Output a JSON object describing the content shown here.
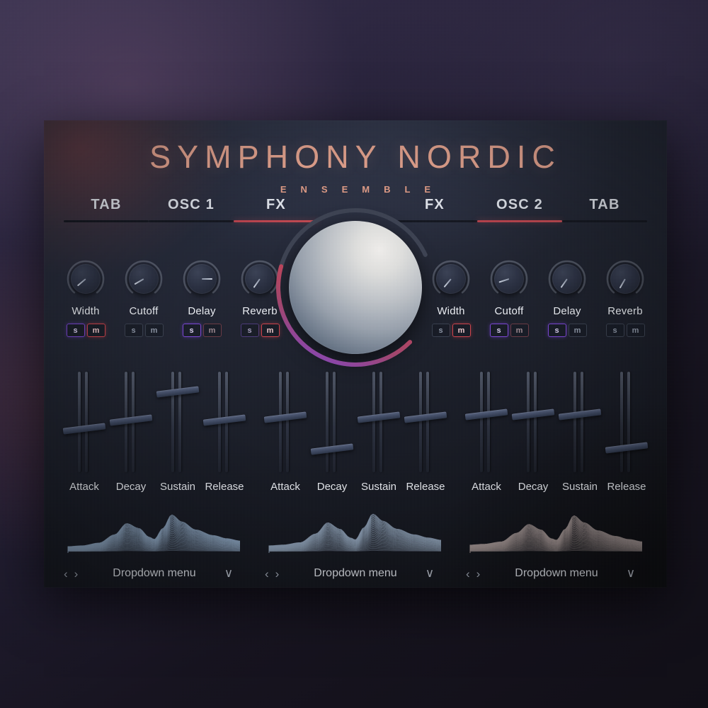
{
  "app": {
    "title": "SYMPHONY NORDIC",
    "subtitle": "ENSEMBLE",
    "accent_salmon": "#eca893",
    "accent_red": "#c24a52",
    "accent_purple": "#7b46d6",
    "panel_bg": "#242938"
  },
  "tabs": {
    "left": [
      {
        "label": "TAB",
        "active": false
      },
      {
        "label": "OSC 1",
        "active": false
      },
      {
        "label": "FX",
        "active": true
      }
    ],
    "right": [
      {
        "label": "FX",
        "active": false
      },
      {
        "label": "OSC 2",
        "active": true
      },
      {
        "label": "TAB",
        "active": false
      }
    ]
  },
  "knob_groups": [
    {
      "side": "left",
      "knobs": [
        {
          "label": "Width",
          "angle": -130,
          "arc": 0.18,
          "s_state": "on-purple",
          "m_state": "on-red"
        },
        {
          "label": "Cutoff",
          "angle": -120,
          "arc": 0.22,
          "s_state": "off",
          "m_state": "off"
        },
        {
          "label": "Delay",
          "angle": 90,
          "arc": 0.8,
          "s_state": "on-purple",
          "m_state": "dim-red"
        },
        {
          "label": "Reverb",
          "angle": -145,
          "arc": 0.1,
          "s_state": "dim-purple",
          "m_state": "on-red"
        }
      ]
    },
    {
      "side": "right",
      "knobs": [
        {
          "label": "Width",
          "angle": -140,
          "arc": 0.14,
          "s_state": "off",
          "m_state": "on-red"
        },
        {
          "label": "Cutoff",
          "angle": -108,
          "arc": 0.28,
          "s_state": "on-purple",
          "m_state": "dim-red"
        },
        {
          "label": "Delay",
          "angle": -145,
          "arc": 0.1,
          "s_state": "on-purple",
          "m_state": "off"
        },
        {
          "label": "Reverb",
          "angle": -150,
          "arc": 0.08,
          "s_state": "off",
          "m_state": "off"
        }
      ]
    }
  ],
  "sm_labels": {
    "solo": "s",
    "mute": "m"
  },
  "slider_groups": [
    {
      "name": "envelope-1",
      "sliders": [
        {
          "label": "Attack",
          "value": 44
        },
        {
          "label": "Decay",
          "value": 52
        },
        {
          "label": "Sustain",
          "value": 80
        },
        {
          "label": "Release",
          "value": 52
        }
      ]
    },
    {
      "name": "envelope-2",
      "sliders": [
        {
          "label": "Attack",
          "value": 55
        },
        {
          "label": "Decay",
          "value": 23
        },
        {
          "label": "Sustain",
          "value": 55
        },
        {
          "label": "Release",
          "value": 55
        }
      ]
    },
    {
      "name": "envelope-3",
      "sliders": [
        {
          "label": "Attack",
          "value": 58
        },
        {
          "label": "Decay",
          "value": 58
        },
        {
          "label": "Sustain",
          "value": 58
        },
        {
          "label": "Release",
          "value": 25
        }
      ]
    }
  ],
  "wave_panels": [
    {
      "name": "wave-1",
      "tint": "#8fa8c4",
      "dropdown": {
        "label": "Dropdown menu",
        "prev": "‹",
        "next": "›",
        "caret": "∨"
      }
    },
    {
      "name": "wave-2",
      "tint": "#93a6bd",
      "dropdown": {
        "label": "Dropdown menu",
        "prev": "‹",
        "next": "›",
        "caret": "∨"
      }
    },
    {
      "name": "wave-3",
      "tint": "#a89a98",
      "dropdown": {
        "label": "Dropdown menu",
        "prev": "‹",
        "next": "›",
        "caret": "∨"
      }
    }
  ],
  "center_knob": {
    "name": "master-sphere-knob",
    "arc_start_deg": 135,
    "arc_sweep_deg": 290,
    "value_fraction": 0.52,
    "arc_gradient_from": "#7b46d6",
    "arc_gradient_to": "#d2434a",
    "arc_track_color": "#3c4252"
  },
  "chart_data": {
    "type": "area",
    "title": "Ensemble spectrum ridgeline",
    "series": [
      {
        "name": "wave-1",
        "x": [
          0,
          0.08,
          0.18,
          0.27,
          0.34,
          0.41,
          0.47,
          0.5,
          0.55,
          0.6,
          0.66,
          0.74,
          0.84,
          0.92,
          1
        ],
        "values": [
          0.16,
          0.18,
          0.25,
          0.46,
          0.74,
          0.62,
          0.4,
          0.34,
          0.62,
          0.96,
          0.78,
          0.58,
          0.44,
          0.36,
          0.3
        ]
      },
      {
        "name": "wave-2",
        "x": [
          0,
          0.08,
          0.18,
          0.27,
          0.34,
          0.41,
          0.47,
          0.5,
          0.55,
          0.6,
          0.66,
          0.74,
          0.84,
          0.92,
          1
        ],
        "values": [
          0.18,
          0.2,
          0.26,
          0.48,
          0.76,
          0.6,
          0.38,
          0.33,
          0.64,
          0.98,
          0.8,
          0.6,
          0.46,
          0.38,
          0.32
        ]
      },
      {
        "name": "wave-3",
        "x": [
          0,
          0.08,
          0.18,
          0.27,
          0.34,
          0.41,
          0.47,
          0.5,
          0.55,
          0.6,
          0.66,
          0.74,
          0.84,
          0.92,
          1
        ],
        "values": [
          0.2,
          0.22,
          0.28,
          0.5,
          0.72,
          0.58,
          0.36,
          0.32,
          0.6,
          0.94,
          0.76,
          0.56,
          0.42,
          0.34,
          0.28
        ]
      }
    ],
    "xlabel": "",
    "ylabel": "",
    "grid": false,
    "legend": "none",
    "ylim": [
      0,
      1
    ],
    "xlim": [
      0,
      1
    ],
    "style": "stacked-ridgeline"
  }
}
